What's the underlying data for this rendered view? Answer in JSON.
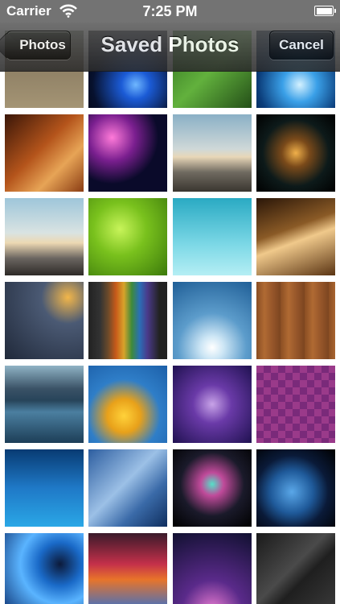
{
  "status_bar": {
    "carrier": "Carrier",
    "time": "7:25 PM",
    "wifi_icon": "wifi-icon",
    "battery_icon": "battery-icon"
  },
  "nav": {
    "back_label": "Photos",
    "title": "Saved Photos",
    "cancel_label": "Cancel"
  },
  "photos": [
    {
      "name": "wooden-boardwalk",
      "bg": "linear-gradient(180deg,#6b7560 0%,#8b7d63 40%,#a49474 100%)"
    },
    {
      "name": "blue-light-streak",
      "bg": "radial-gradient(circle at 60% 70%,#6fb7ff 0%,#1b5bd6 20%,#07112e 60%,#000 100%)"
    },
    {
      "name": "green-grass",
      "bg": "linear-gradient(135deg,#2c6b1d,#62b13d 50%,#244f18)"
    },
    {
      "name": "blue-bokeh",
      "bg": "radial-gradient(circle at 55% 70%,#d4f1ff 0%,#3aa0e8 25%,#0b3d7a 60%,#021326 100%)"
    },
    {
      "name": "orange-swirls",
      "bg": "linear-gradient(135deg,#3a1608,#b4541b 45%,#e7a456 70%,#8a3c13)"
    },
    {
      "name": "pink-cyan-bokeh",
      "bg": "radial-gradient(circle at 30% 30%,#ff7ad9 0%,#7a1f8f 30%,#0a0a2a 60%),radial-gradient(circle at 70% 70%,#44e1ff 0%,#0e3a7a 40%)"
    },
    {
      "name": "road-horizon",
      "bg": "linear-gradient(180deg,#8ab0c6 0%,#cfd8d8 45%,#e8d7b8 55%,#6f6a60 75%,#3a3630 100%)"
    },
    {
      "name": "dark-bokeh",
      "bg": "radial-gradient(circle at 50% 50%,#f0b04a 0%,#7a4a1a 25%,#0d1a1a 60%,#000 100%)"
    },
    {
      "name": "road-sky",
      "bg": "linear-gradient(180deg,#9ec6da 0%,#d9e3e2 45%,#ecd8b2 58%,#6a6560 78%,#2e2a27 100%)"
    },
    {
      "name": "green-water-drops",
      "bg": "radial-gradient(circle at 40% 40%,#c8f45a 0%,#79c11d 40%,#3c7a0b 100%)"
    },
    {
      "name": "teal-gradient",
      "bg": "linear-gradient(180deg,#2aaac3 0%,#7cd8e6 60%,#b5eef4 100%)"
    },
    {
      "name": "brown-light-rays",
      "bg": "linear-gradient(160deg,#2a1608 0%,#8a5a26 40%,#f0c98b 55%,#5a3413 100%)"
    },
    {
      "name": "rain-window",
      "bg": "radial-gradient(circle at 80% 20%,#f2b64a 0%,#4b5a74 30%,#20293a 100%)"
    },
    {
      "name": "rainbow-stripes",
      "bg": "linear-gradient(90deg,#222 0%,#333 15%,#6b4a2a 25%,#c85a1a 35%,#d8a32a 45%,#3e8a3a 55%,#2a6fb6 65%,#4a3a8a 75%,#222 90%)"
    },
    {
      "name": "cloudy-sky-sun",
      "bg": "radial-gradient(circle at 50% 85%,#ffffff 0%,#cde6f5 15%,#5c9ccb 45%,#1f5e96 100%)"
    },
    {
      "name": "wood-planks",
      "bg": "repeating-linear-gradient(90deg,#8a4e23 0px,#b06a33 10px,#96562a 20px,#7c4520 30px)"
    },
    {
      "name": "lake-mountains",
      "bg": "linear-gradient(180deg,#8fb3c5 0%,#3a5266 30%,#27445a 45%,#4b7fa0 60%,#1d3e57 100%)"
    },
    {
      "name": "yellow-flower",
      "bg": "radial-gradient(circle at 45% 65%,#ffd23a 0%,#e8a11a 25%,#2f7ec8 55%,#1c5fa8 100%)"
    },
    {
      "name": "purple-blur",
      "bg": "radial-gradient(circle at 50% 50%,#c8a3e8 0%,#6a3aa8 35%,#1f1150 100%)"
    },
    {
      "name": "purple-pixels",
      "bg": "repeating-conic-gradient(#7a2a7a 0% 25%,#9a3a8a 0% 50%) 0 0/18px 18px"
    },
    {
      "name": "blue-curve",
      "bg": "linear-gradient(180deg,#083b73 0%,#1f79c7 50%,#2aa7e6 100%)"
    },
    {
      "name": "milky-way",
      "bg": "linear-gradient(135deg,#2d5ea0 0%,#9cc0e6 45%,#3a6aa8 70%,#0f2e5e 100%)"
    },
    {
      "name": "colorful-bokeh",
      "bg": "radial-gradient(circle at 50% 45%,#55e0c8 0%,#c04a9a 20%,#1a1a2a 55%,#000 100%)"
    },
    {
      "name": "earth-from-space",
      "bg": "radial-gradient(circle at 45% 55%,#5aa7e8 0%,#1f5a9a 35%,#0a1a38 60%,#000 100%)"
    },
    {
      "name": "blue-swirl",
      "bg": "radial-gradient(circle at 70% 40%,#0c1a3a 0%,#1a6ac8 30%,#5ab4ff 55%,#123a7a 100%)"
    },
    {
      "name": "red-glow",
      "bg": "linear-gradient(180deg,#3a1a2a 0%,#c4304a 40%,#e8742a 60%,#3a70c8 100%)"
    },
    {
      "name": "dotted-lights",
      "bg": "radial-gradient(circle at 50% 100%,#e67ad0 0%,#5a2a8a 35%,#101030 100%)"
    },
    {
      "name": "dark-cubes",
      "bg": "linear-gradient(135deg,#1a1a1a 0%,#4a4a4a 45%,#1f1f1f 60%,#3a3a3a 100%)"
    }
  ]
}
